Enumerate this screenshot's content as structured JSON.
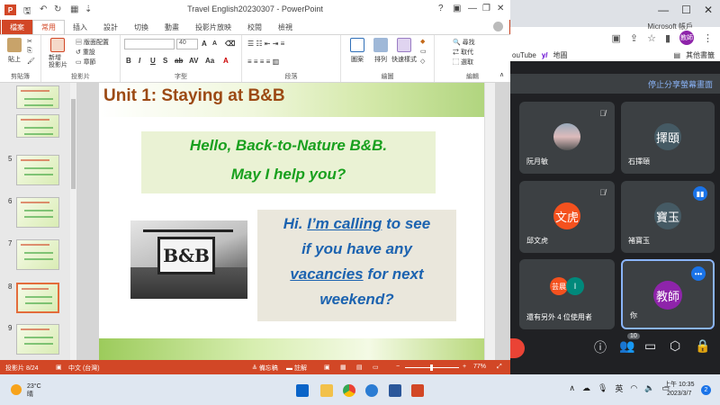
{
  "ppt": {
    "logo": "P",
    "doc_title": "Travel English20230307 - PowerPoint",
    "help": "?",
    "tabs": [
      "檔案",
      "常用",
      "插入",
      "設計",
      "切換",
      "動畫",
      "投影片放映",
      "校閱",
      "檢視"
    ],
    "active_tab": "常用",
    "account": "Microsoft 帳戶",
    "ribbon": {
      "paste": "貼上",
      "new_slide": "新增\n投影片",
      "layout": "版面配置",
      "reset": "重設",
      "section": "章節",
      "font_size": "40",
      "find": "尋找",
      "replace": "取代",
      "select": "選取",
      "shapes": "圖案",
      "arrange": "排列",
      "quick_styles": "快速樣式",
      "groups": {
        "clipboard": "剪貼簿",
        "slides": "投影片",
        "font": "字型",
        "paragraph": "段落",
        "drawing": "繪圖",
        "editing": "編輯"
      }
    },
    "thumbnails": [
      {
        "num": "",
        "sel": false
      },
      {
        "num": "",
        "sel": false
      },
      {
        "num": "5",
        "sel": false
      },
      {
        "num": "6",
        "sel": false
      },
      {
        "num": "7",
        "sel": false
      },
      {
        "num": "8",
        "sel": true
      },
      {
        "num": "9",
        "sel": false
      }
    ],
    "slide": {
      "title": "Unit 1: Staying at B&B",
      "greeting_1": "Hello, Back-to-Nature B&B.",
      "greeting_2": "May I help you?",
      "sign_text": "B&B",
      "reply": {
        "l1a": "Hi. ",
        "l1b": "I’m calling",
        "l1c": " to see",
        "l2": "if you have any",
        "l3a": "vacancies",
        "l3b": " for next",
        "l4": "weekend?"
      }
    },
    "status": {
      "slide_pos": "投影片 8/24",
      "lang": "中文 (台灣)",
      "notes": "備忘稿",
      "comments": "註解",
      "zoom": "77%",
      "zoom_value": 0.77
    }
  },
  "browser": {
    "profile": "教師",
    "bookmarks": [
      "ouTube",
      "地圖",
      "其他書籤"
    ]
  },
  "meet": {
    "banner": "停止分享螢幕畫面",
    "tiles": [
      {
        "name": "阮月敏",
        "avatar": "",
        "muted": true
      },
      {
        "name": "石擇頤",
        "avatar": "擇頤",
        "muted": false
      },
      {
        "name": "邱文虎",
        "avatar": "文虎",
        "muted": true
      },
      {
        "name": "褚寶玉",
        "avatar": "寶玉",
        "muted": false
      },
      {
        "name": "還有另外 4 位使用者",
        "avatar": "",
        "muted": false
      },
      {
        "name": "你",
        "avatar": "教師",
        "muted": false
      }
    ],
    "others_avatar_1": "芸晨",
    "others_avatar_2": "I",
    "people_count": "10",
    "colors": {
      "accent": "#1a73e8",
      "end_call": "#ea4335",
      "tile": "#3c4043"
    }
  },
  "taskbar": {
    "weather_temp": "23°C",
    "weather_desc": "晴",
    "ime": "英",
    "time": "上午 10:35",
    "date": "2023/3/7",
    "notifications": "2"
  }
}
